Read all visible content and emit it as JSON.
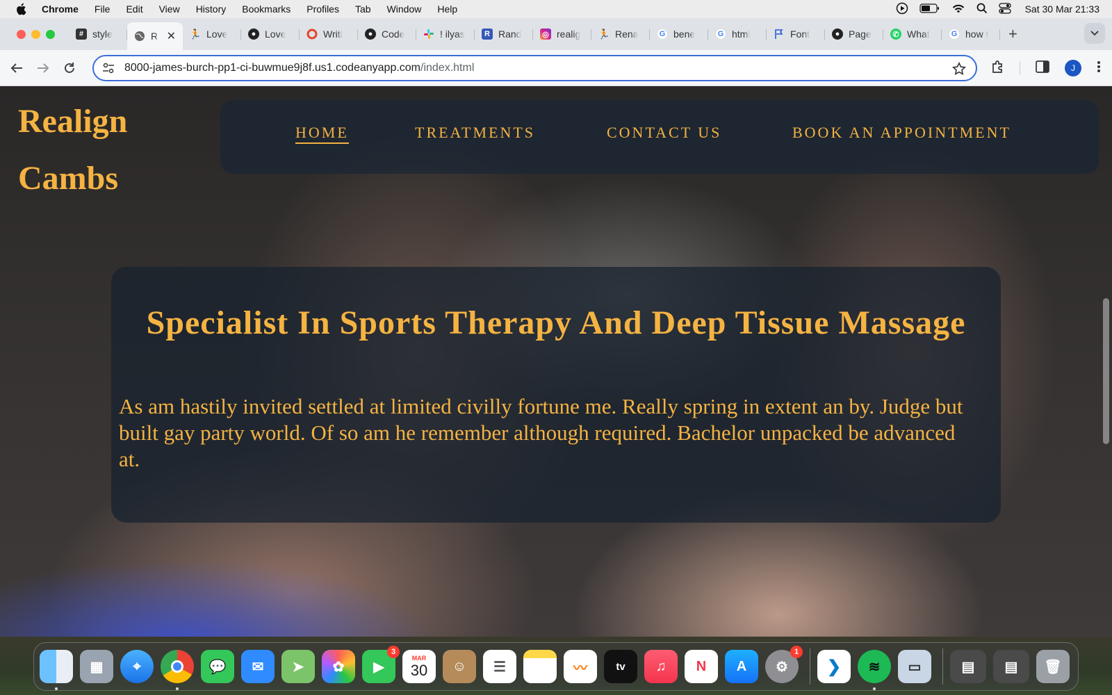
{
  "menubar": {
    "app": "Chrome",
    "items": [
      "File",
      "Edit",
      "View",
      "History",
      "Bookmarks",
      "Profiles",
      "Tab",
      "Window",
      "Help"
    ],
    "clock": "Sat 30 Mar  21:33"
  },
  "tabs": [
    {
      "label": "style",
      "icon": "hash-icon"
    },
    {
      "label": "R",
      "icon": "globe-icon",
      "active": true
    },
    {
      "label": "Love",
      "icon": "runner-icon"
    },
    {
      "label": "Love",
      "icon": "github-icon"
    },
    {
      "label": "Writi",
      "icon": "ring-icon"
    },
    {
      "label": "Code",
      "icon": "github-icon"
    },
    {
      "label": "! ilyas",
      "icon": "slack-icon"
    },
    {
      "label": "Rand",
      "icon": "r-icon"
    },
    {
      "label": "realig",
      "icon": "instagram-icon"
    },
    {
      "label": "Rena",
      "icon": "figure-icon"
    },
    {
      "label": "bene",
      "icon": "google-icon"
    },
    {
      "label": "html",
      "icon": "google-icon"
    },
    {
      "label": "Font",
      "icon": "flag-icon"
    },
    {
      "label": "Page",
      "icon": "github-icon"
    },
    {
      "label": "What",
      "icon": "whatsapp-icon"
    },
    {
      "label": "how t",
      "icon": "google-icon"
    }
  ],
  "address_bar": {
    "host": "8000-james-burch-pp1-ci-buwmue9j8f.us1.codeanyapp.com",
    "path": "/index.html"
  },
  "profile_initial": "J",
  "site": {
    "brand_line1": "Realign",
    "brand_line2": "Cambs",
    "nav": [
      "HOME",
      "TREATMENTS",
      "CONTACT US",
      "BOOK AN APPOINTMENT"
    ],
    "active_nav": "HOME",
    "hero_title": "Specialist In Sports Therapy And Deep Tissue Massage",
    "hero_text": "As am hastily invited settled at limited civilly fortune me. Really spring in extent an by. Judge but built gay party world. Of so am he remember although required. Bachelor unpacked be advanced at."
  },
  "colors": {
    "brand_gold": "#f5b342",
    "panel": "#16212e",
    "omnibox_border": "#3a6fd8"
  },
  "dock": {
    "calendar_month": "MAR",
    "calendar_day": "30",
    "facetime_badge": "3",
    "settings_badge": "1",
    "appletv_label": "tv"
  }
}
